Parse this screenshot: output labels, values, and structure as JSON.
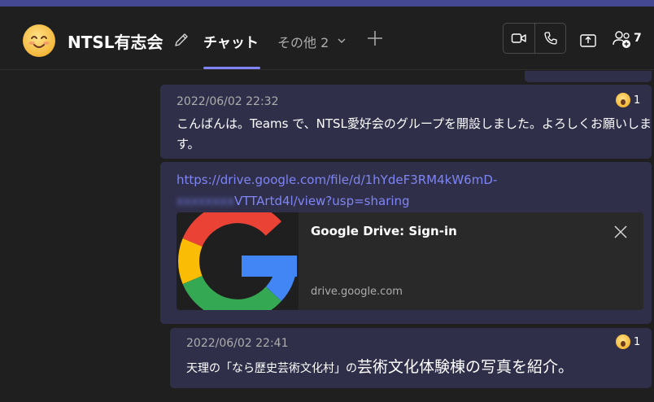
{
  "header": {
    "title": "NTSL有志会",
    "tab_chat": "チャット",
    "tab_more": "その他 2",
    "participant_count": "7"
  },
  "messages": [
    {
      "timestamp": "2022/06/02 22:32",
      "text_line1": "こんばんは。Teams で、NTSL愛好会のグループを開設しました。よろしくお願いしま",
      "text_line2": "す。",
      "reaction_icon": "surprised-face-emoji",
      "reaction_count": "1"
    },
    {
      "link_line1": "https://drive.google.com/file/d/1hYdeF3RM4kW6mD-",
      "link_blurred": "xxxxxxxx",
      "link_line2": "VTTArtd4l/view?usp=sharing",
      "card": {
        "title": "Google Drive: Sign-in",
        "domain": "drive.google.com",
        "thumbnail_icon": "google-g-logo"
      }
    },
    {
      "timestamp": "2022/06/02 22:41",
      "text_small": "天理の「なら歴史芸術文化村」の",
      "text_large": "芸術文化体験棟の写真を紹介。",
      "reaction_icon": "surprised-face-emoji",
      "reaction_count": "1"
    }
  ],
  "colors": {
    "accent": "#7f85f5",
    "top_strip": "#444791",
    "bubble": "#2f2f4a",
    "background": "#1f1f1f"
  }
}
